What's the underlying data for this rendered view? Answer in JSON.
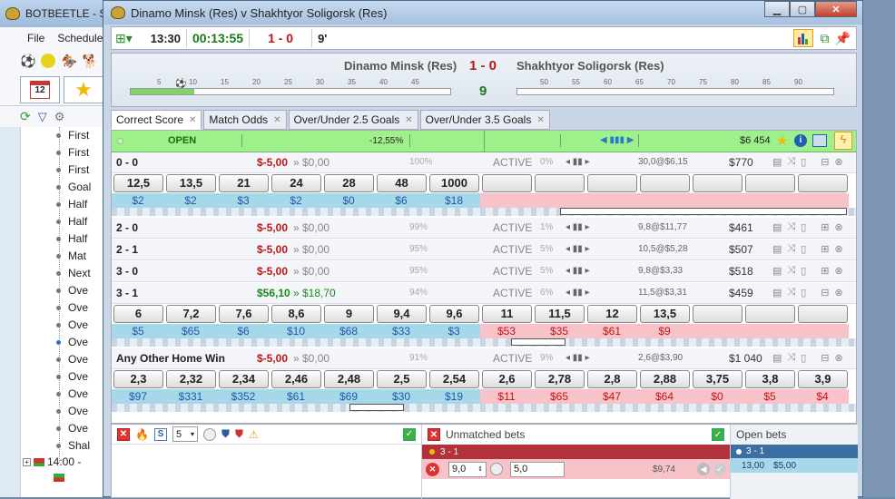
{
  "back_window": {
    "title": "BOTBEETLE - S",
    "menu": [
      "File",
      "Schedule"
    ],
    "tree_items": [
      {
        "label": "First",
        "blue": false
      },
      {
        "label": "First",
        "blue": false
      },
      {
        "label": "First",
        "blue": false
      },
      {
        "label": "Goal",
        "blue": false
      },
      {
        "label": "Half",
        "blue": false
      },
      {
        "label": "Half",
        "blue": false
      },
      {
        "label": "Half",
        "blue": false
      },
      {
        "label": "Mat",
        "blue": false
      },
      {
        "label": "Next",
        "blue": false
      },
      {
        "label": "Ove",
        "blue": false
      },
      {
        "label": "Ove",
        "blue": false
      },
      {
        "label": "Ove",
        "blue": false
      },
      {
        "label": "Ove",
        "blue": true
      },
      {
        "label": "Ove",
        "blue": false
      },
      {
        "label": "Ove",
        "blue": false
      },
      {
        "label": "Ove",
        "blue": false
      },
      {
        "label": "Ove",
        "blue": false
      },
      {
        "label": "Ove",
        "blue": false
      },
      {
        "label": "Shal",
        "blue": false
      }
    ],
    "tree_bottom": "14:00 -",
    "calendar_day": "12"
  },
  "main_window": {
    "title": "Dinamo Minsk (Res) v Shakhtyor Soligorsk (Res)",
    "toolbar": {
      "time": "13:30",
      "elapsed": "00:13:55",
      "score": "1 - 0",
      "minute": "9'"
    },
    "score_panel": {
      "home": "Dinamo Minsk (Res)",
      "away": "Shakhtyor Soligorsk (Res)",
      "score": "1 - 0",
      "minute": "9",
      "home_ticks": [
        "5",
        "10",
        "15",
        "20",
        "25",
        "30",
        "35",
        "40",
        "45"
      ],
      "away_ticks": [
        "50",
        "55",
        "60",
        "65",
        "70",
        "75",
        "80",
        "85",
        "90"
      ],
      "home_progress": 0.2
    },
    "tabs": [
      {
        "label": "Correct Score",
        "active": true
      },
      {
        "label": "Match Odds",
        "active": false
      },
      {
        "label": "Over/Under 2.5 Goals",
        "active": false
      },
      {
        "label": "Over/Under 3.5 Goals",
        "active": false
      }
    ],
    "open_bar": {
      "status": "OPEN",
      "pct": "-12,55%",
      "volume": "$6 454"
    },
    "runners_collapsed_label": "ACTIVE",
    "runners": [
      {
        "name": "0 - 0",
        "pl": "$-5,00",
        "pl_pos": false,
        "pl2": "» $0,00",
        "pl2_pos": false,
        "pct": "100%",
        "status": "ACTIVE",
        "pct2": "0%",
        "avg": "30,0@$6,15",
        "vol": "$770",
        "expanded": true,
        "back_odds": [
          "12,5",
          "13,5",
          "21",
          "24",
          "28",
          "48",
          "1000"
        ],
        "back_stakes": [
          "$2",
          "$2",
          "$3",
          "$2",
          "$0",
          "$6",
          "$18"
        ],
        "lay_odds": [
          "",
          "",
          "",
          "",
          "",
          "",
          ""
        ],
        "lay_stakes": [
          "",
          "",
          "",
          "",
          "",
          "",
          ""
        ]
      },
      {
        "name": "2 - 0",
        "pl": "$-5,00",
        "pl_pos": false,
        "pl2": "» $0,00",
        "pl2_pos": false,
        "pct": "99%",
        "status": "ACTIVE",
        "pct2": "1%",
        "avg": "9,8@$11,77",
        "vol": "$461",
        "expanded": false
      },
      {
        "name": "2 - 1",
        "pl": "$-5,00",
        "pl_pos": false,
        "pl2": "» $0,00",
        "pl2_pos": false,
        "pct": "95%",
        "status": "ACTIVE",
        "pct2": "5%",
        "avg": "10,5@$5,28",
        "vol": "$507",
        "expanded": false
      },
      {
        "name": "3 - 0",
        "pl": "$-5,00",
        "pl_pos": false,
        "pl2": "» $0,00",
        "pl2_pos": false,
        "pct": "95%",
        "status": "ACTIVE",
        "pct2": "5%",
        "avg": "9,8@$3,33",
        "vol": "$518",
        "expanded": false
      },
      {
        "name": "3 - 1",
        "pl": "$56,10",
        "pl_pos": true,
        "pl2": "» $18,70",
        "pl2_pos": true,
        "pct": "94%",
        "status": "ACTIVE",
        "pct2": "6%",
        "avg": "11,5@$3,31",
        "vol": "$459",
        "expanded": true,
        "back_odds": [
          "6",
          "7,2",
          "7,6",
          "8,6",
          "9",
          "9,4",
          "9,6"
        ],
        "back_stakes": [
          "$5",
          "$65",
          "$6",
          "$10",
          "$68",
          "$33",
          "$3"
        ],
        "lay_odds": [
          "11",
          "11,5",
          "12",
          "13,5",
          "",
          "",
          ""
        ],
        "lay_stakes": [
          "$53",
          "$35",
          "$61",
          "$9",
          "",
          "",
          ""
        ]
      },
      {
        "name": "Any Other Home Win",
        "pl": "$-5,00",
        "pl_pos": false,
        "pl2": "» $0,00",
        "pl2_pos": false,
        "pct": "91%",
        "status": "ACTIVE",
        "pct2": "9%",
        "avg": "2,6@$3,90",
        "vol": "$1 040",
        "expanded": true,
        "back_odds": [
          "2,3",
          "2,32",
          "2,34",
          "2,46",
          "2,48",
          "2,5",
          "2,54"
        ],
        "back_stakes": [
          "$97",
          "$331",
          "$352",
          "$61",
          "$69",
          "$30",
          "$19"
        ],
        "lay_odds": [
          "2,6",
          "2,78",
          "2,8",
          "2,88",
          "3,75",
          "3,8",
          "3,9"
        ],
        "lay_stakes": [
          "$11",
          "$65",
          "$47",
          "$64",
          "$0",
          "$5",
          "$4"
        ]
      }
    ],
    "bottom": {
      "spinner": "5",
      "unmatched_title": "Unmatched bets",
      "unmatched_selection": "3 - 1",
      "unmatched_odds": "9,0",
      "unmatched_stake": "5,0",
      "unmatched_payout": "$9,74",
      "open_title": "Open bets",
      "open_selection": "3 - 1",
      "open_odds": "13,00",
      "open_stake": "$5,00"
    }
  },
  "colors": {
    "back": "#a7d8ea",
    "lay": "#f7c3c8",
    "open": "#9ef08a",
    "loss": "#c01515",
    "profit": "#1a8a1a"
  }
}
